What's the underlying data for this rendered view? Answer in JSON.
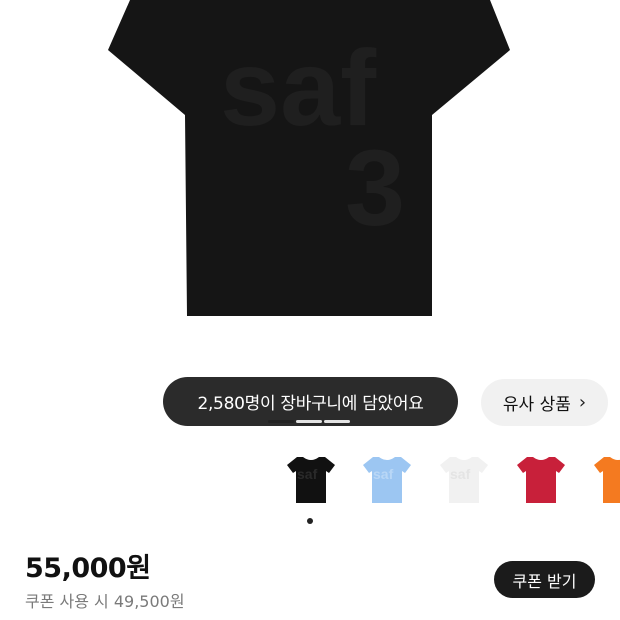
{
  "product_image": {
    "print_line1": "saf",
    "print_line2": "3"
  },
  "cart_count_banner": "2,580명이 장바구니에 담았어요",
  "similar_button": {
    "label": "유사 상품",
    "chevron_icon": "chevron-right-icon"
  },
  "gallery": {
    "segments": 3,
    "active_index": 0
  },
  "color_options": [
    {
      "name": "black",
      "color": "#111111",
      "print_color": "#2a2a2a",
      "print": "saf 3"
    },
    {
      "name": "light-blue",
      "color": "#9cc6f2",
      "print_color": "#b9d7f6",
      "print": "saf 3"
    },
    {
      "name": "white",
      "color": "#f1f1f1",
      "print_color": "#e4e4e4",
      "print": "saf 3"
    },
    {
      "name": "red",
      "color": "#c8203a",
      "print_color": "#c8203a",
      "print": ""
    },
    {
      "name": "orange",
      "color": "#f47a20",
      "print_color": "#f47a20",
      "print": ""
    }
  ],
  "price": "55,000원",
  "coupon_price": "쿠폰 사용 시 49,500원",
  "coupon_button": "쿠폰 받기"
}
